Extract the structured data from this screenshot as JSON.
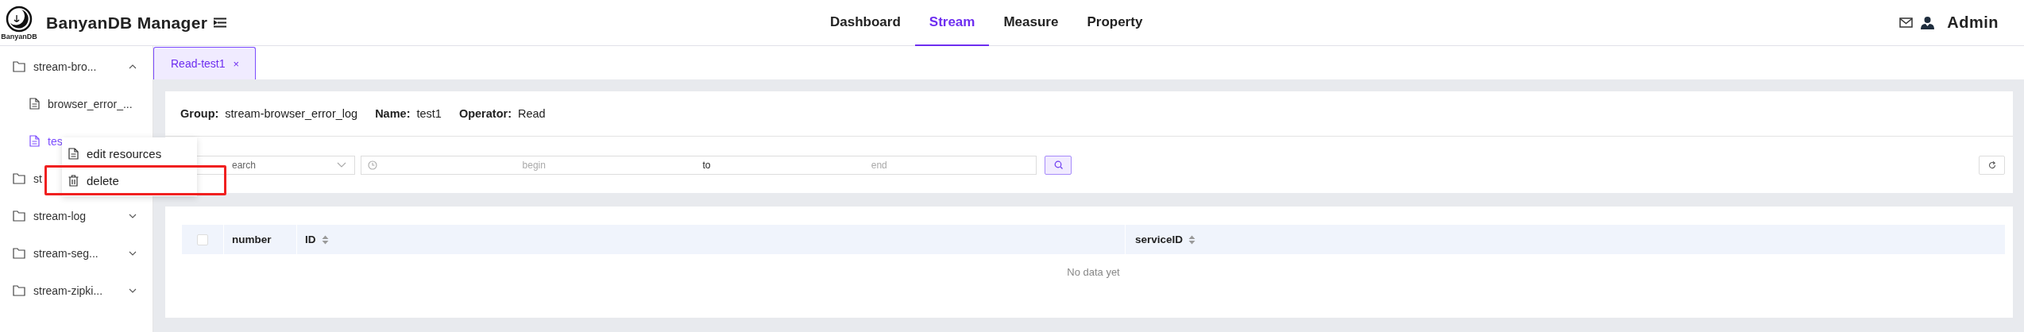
{
  "header": {
    "logo_caption": "BanyanDB",
    "title": "BanyanDB Manager",
    "nav": [
      {
        "label": "Dashboard",
        "selected": false
      },
      {
        "label": "Stream",
        "selected": true
      },
      {
        "label": "Measure",
        "selected": false
      },
      {
        "label": "Property",
        "selected": false
      }
    ],
    "user": "Admin"
  },
  "sidebar": {
    "items": [
      {
        "label": "stream-bro...",
        "kind": "folder",
        "expanded": true,
        "children": [
          {
            "label": "browser_error_...",
            "kind": "file",
            "selected": false
          },
          {
            "label": "tes",
            "kind": "file",
            "selected": true
          }
        ]
      },
      {
        "label": "st",
        "kind": "folder"
      },
      {
        "label": "stream-log",
        "kind": "folder",
        "expanded": false
      },
      {
        "label": "stream-seg...",
        "kind": "folder",
        "expanded": false
      },
      {
        "label": "stream-zipki...",
        "kind": "folder",
        "expanded": false
      }
    ]
  },
  "context_menu": {
    "items": [
      {
        "label": "edit resources",
        "kind": "edit",
        "highlighted": false
      },
      {
        "label": "delete",
        "kind": "delete",
        "highlighted": true
      }
    ]
  },
  "tabs": [
    {
      "label": "Read-test1",
      "selected": true,
      "close": "×"
    }
  ],
  "info": [
    {
      "label": "Group:",
      "value": "stream-browser_error_log"
    },
    {
      "label": "Name:",
      "value": "test1"
    },
    {
      "label": "Operator:",
      "value": "Read"
    }
  ],
  "filter": {
    "search": {
      "placeholder": "earch"
    },
    "begin": {
      "placeholder": "begin"
    },
    "separator": "to",
    "end": {
      "placeholder": "end"
    }
  },
  "table": {
    "select_all": {
      "checked": false
    },
    "columns": [
      {
        "label": "number",
        "sortable": false
      },
      {
        "label": "ID",
        "sortable": true
      },
      {
        "label": "serviceID",
        "sortable": true
      }
    ],
    "empty_text": "No data yet"
  }
}
